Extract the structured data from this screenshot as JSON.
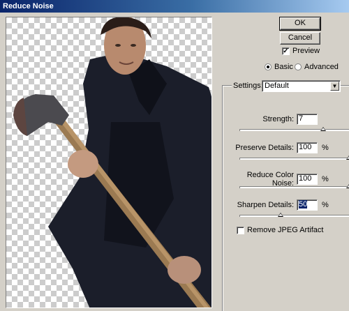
{
  "window": {
    "title": "Reduce Noise"
  },
  "buttons": {
    "ok": "OK",
    "cancel": "Cancel"
  },
  "preview": {
    "label": "Preview",
    "checked": true
  },
  "mode": {
    "basic": "Basic",
    "advanced": "Advanced",
    "selected": "Basic"
  },
  "settings": {
    "label": "Settings:",
    "value": "Default"
  },
  "strength": {
    "label": "Strength:",
    "value": "7",
    "slider_fraction": 0.7
  },
  "preserve_details": {
    "label": "Preserve Details:",
    "value": "100",
    "unit": "%",
    "slider_fraction": 1.0
  },
  "reduce_color_noise": {
    "label": "Reduce Color Noise:",
    "value": "100",
    "unit": "%",
    "slider_fraction": 1.0
  },
  "sharpen_details": {
    "label": "Sharpen Details:",
    "value": "50",
    "unit": "%",
    "slider_fraction": 0.5
  },
  "jpeg": {
    "label": "Remove JPEG Artifact",
    "checked": false
  }
}
